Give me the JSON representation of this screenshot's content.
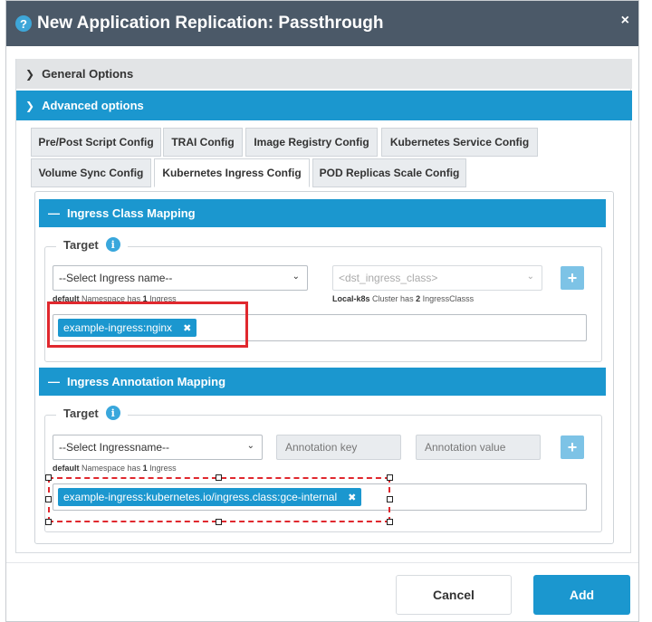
{
  "modal": {
    "title": "New Application Replication: Passthrough",
    "help_icon": "help-icon",
    "close_icon": "close-icon",
    "close_glyph": "×"
  },
  "accordion": {
    "general": "General Options",
    "advanced": "Advanced options"
  },
  "tabs": [
    {
      "label": "Pre/Post Script Config",
      "active": false
    },
    {
      "label": "TRAI Config",
      "active": false
    },
    {
      "label": "Image Registry Config",
      "active": false
    },
    {
      "label": "Kubernetes Service Config",
      "active": false
    },
    {
      "label": "Volume Sync Config",
      "active": false
    },
    {
      "label": "Kubernetes Ingress Config",
      "active": true
    },
    {
      "label": "POD Replicas Scale Config",
      "active": false
    }
  ],
  "class_mapping": {
    "header": "Ingress Class Mapping",
    "legend": "Target",
    "select_ingress": "--Select Ingress name--",
    "select_class_placeholder": "<dst_ingress_class>",
    "hint_left_ns": "default",
    "hint_left_text": "Namespace has",
    "hint_left_count": "1",
    "hint_left_unit": "Ingress",
    "hint_right_cluster": "Local-k8s",
    "hint_right_text": "Cluster has",
    "hint_right_count": "2",
    "hint_right_unit": "IngressClasss",
    "tag": "example-ingress:nginx"
  },
  "annotation_mapping": {
    "header": "Ingress Annotation Mapping",
    "legend": "Target",
    "select_ingress": "--Select Ingressname--",
    "key_placeholder": "Annotation key",
    "value_placeholder": "Annotation value",
    "hint_ns": "default",
    "hint_text": "Namespace has",
    "hint_count": "1",
    "hint_unit": "Ingress",
    "tag": "example-ingress:kubernetes.io/ingress.class:gce-internal"
  },
  "footer": {
    "cancel": "Cancel",
    "add": "Add"
  },
  "colors": {
    "header_bg": "#4b5968",
    "accent": "#1b97cf",
    "highlight": "#e0282e"
  }
}
